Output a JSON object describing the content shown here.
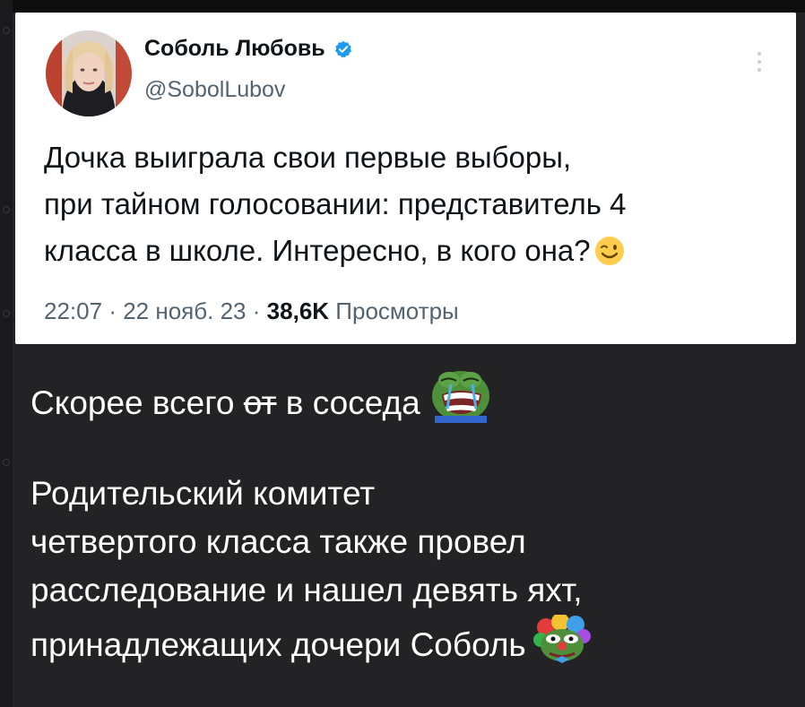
{
  "tweet": {
    "author_name": "Соболь Любовь",
    "handle": "@SobolLubov",
    "text_lines": [
      "Дочка выиграла свои первые выборы,",
      "при тайном голосовании: представитель 4",
      "класса в школе. Интересно, в кого она?"
    ],
    "time": "22:07",
    "separator": "·",
    "date": "22 нояб. 23",
    "views_count": "38,6K",
    "views_label": "Просмотры"
  },
  "comment": {
    "line1_before": "Скорее всего ",
    "line1_strike": "от",
    "line1_after": " в соседа",
    "paragraph2": [
      "Родительский комитет",
      "четвертого класса также провел",
      "расследование и нашел девять яхт,",
      "принадлежащих дочери Соболь"
    ]
  },
  "colors": {
    "tweet_bg": "#ffffff",
    "chat_bg": "#232325",
    "secondary_text": "#536471",
    "verified_blue": "#1d9bf0"
  },
  "icons": [
    "avatar",
    "verified-badge-icon",
    "more-options-icon",
    "winking-emoji-icon",
    "crying-pepe-sticker",
    "clown-pepe-sticker"
  ]
}
